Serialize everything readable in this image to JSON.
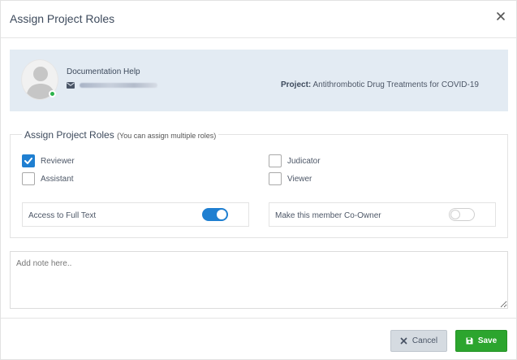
{
  "modal": {
    "title": "Assign Project Roles",
    "close_icon": "close-icon"
  },
  "member": {
    "name": "Documentation Help",
    "email_icon": "envelope-icon",
    "status": "online",
    "project_label": "Project:",
    "project_name": "Antithrombotic Drug Treatments for COVID-19"
  },
  "roles": {
    "legend": "Assign Project Roles",
    "legend_hint": "(You can assign multiple roles)",
    "options": [
      {
        "label": "Reviewer",
        "checked": true
      },
      {
        "label": "Judicator",
        "checked": false
      },
      {
        "label": "Assistant",
        "checked": false
      },
      {
        "label": "Viewer",
        "checked": false
      }
    ],
    "toggles": [
      {
        "label": "Access to Full Text",
        "on": true
      },
      {
        "label": "Make this member Co-Owner",
        "on": false
      }
    ]
  },
  "note": {
    "placeholder": "Add note here..",
    "value": ""
  },
  "footer": {
    "cancel_label": "Cancel",
    "save_label": "Save"
  },
  "colors": {
    "accent": "#1f7fd1",
    "save": "#2ca52e",
    "member_bg": "#e3ebf3",
    "online": "#2bb34b"
  }
}
